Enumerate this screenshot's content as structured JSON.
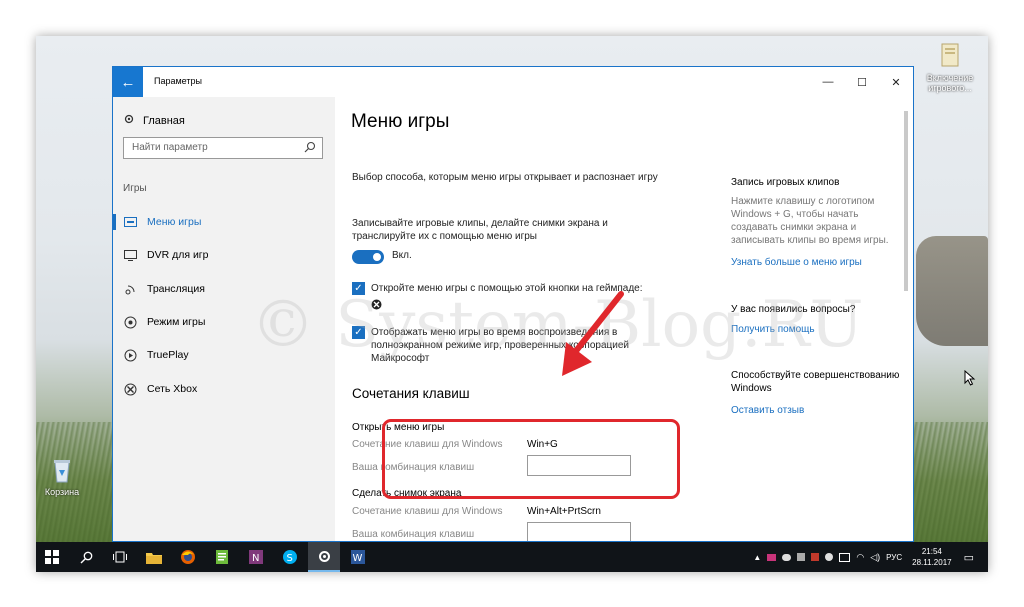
{
  "desktop": {
    "icon_top_right": "Включение игрового...",
    "recycle_bin": "Корзина"
  },
  "window": {
    "title": "Параметры",
    "back_glyph": "←",
    "minimize_glyph": "—",
    "maximize_glyph": "☐",
    "close_glyph": "✕"
  },
  "sidebar": {
    "home": "Главная",
    "search_placeholder": "Найти параметр",
    "section": "Игры",
    "items": [
      {
        "label": "Меню игры",
        "icon": "game-menu-icon",
        "selected": true
      },
      {
        "label": "DVR для игр",
        "icon": "dvr-icon"
      },
      {
        "label": "Трансляция",
        "icon": "broadcast-icon"
      },
      {
        "label": "Режим игры",
        "icon": "game-mode-icon"
      },
      {
        "label": "TruePlay",
        "icon": "trueplay-icon"
      },
      {
        "label": "Сеть Xbox",
        "icon": "xbox-icon"
      }
    ]
  },
  "main": {
    "title": "Меню игры",
    "intro": "Выбор способа, которым меню игры открывает и распознает игру",
    "record_desc": "Записывайте игровые клипы, делайте снимки экрана и транслируйте их с помощью меню игры",
    "toggle_label": "Вкл.",
    "checkbox1": "Откройте меню игры с помощью этой кнопки на геймпаде:",
    "checkbox2": "Отображать меню игры во время воспроизведения в полноэкранном режиме игр, проверенных корпорацией Майкрософт",
    "shortcuts_title": "Сочетания клавиш",
    "group1_title": "Открыть меню игры",
    "shortcut_label": "Сочетание клавиш для Windows",
    "custom_label": "Ваша комбинация клавиш",
    "group1_value": "Win+G",
    "group2_title": "Сделать снимок экрана",
    "group2_value": "Win+Alt+PrtScrn"
  },
  "right_panel": {
    "title1": "Запись игровых клипов",
    "desc1": "Нажмите клавишу с логотипом Windows + G, чтобы начать создавать снимки экрана и записывать клипы во время игры.",
    "link1": "Узнать больше о меню игры",
    "title2": "У вас появились вопросы?",
    "link2": "Получить помощь",
    "title3": "Способствуйте совершенствованию Windows",
    "link3": "Оставить отзыв"
  },
  "taskbar": {
    "lang": "РУС",
    "time": "21:54",
    "date": "28.11.2017"
  },
  "watermark": "© System-Blog.RU",
  "colors": {
    "accent": "#1a6fc0",
    "annotation_red": "#e0272c"
  }
}
